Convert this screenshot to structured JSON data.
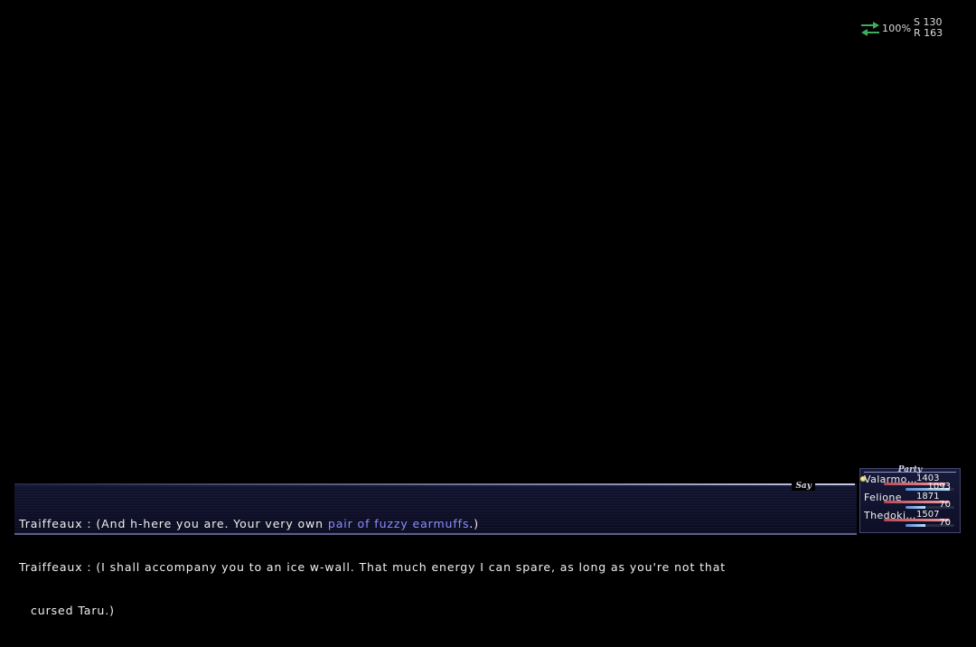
{
  "network": {
    "percent": "100%",
    "send": "S 130",
    "receive": "R 163",
    "icon": "send-receive-arrows-icon",
    "color": "#3fae5a"
  },
  "chat": {
    "mode": "Say",
    "lines": [
      {
        "speaker": "Traiffeaux",
        "pre": "(And h-here you are. Your very own ",
        "highlight": "pair of fuzzy earmuffs",
        "post": ".)"
      },
      {
        "speaker": "Traiffeaux",
        "text": "(I shall accompany you to an ice w-wall. That much energy I can spare, as long as you're not that"
      },
      {
        "continuation": "cursed Taru.)"
      }
    ],
    "highlight_color": "#8e8eff"
  },
  "party": {
    "title": "Party",
    "members": [
      {
        "name": "Valarmo…",
        "hp": "1403",
        "mp": "1093",
        "hp_fraction": 0.95,
        "mp_fraction": 0.9,
        "selected": true
      },
      {
        "name": "Felione",
        "hp": "1871",
        "mp": "70",
        "hp_fraction": 1.0,
        "mp_fraction": 0.4
      },
      {
        "name": "Thedoki…",
        "hp": "1507",
        "mp": "70",
        "hp_fraction": 1.0,
        "mp_fraction": 0.4
      }
    ]
  }
}
